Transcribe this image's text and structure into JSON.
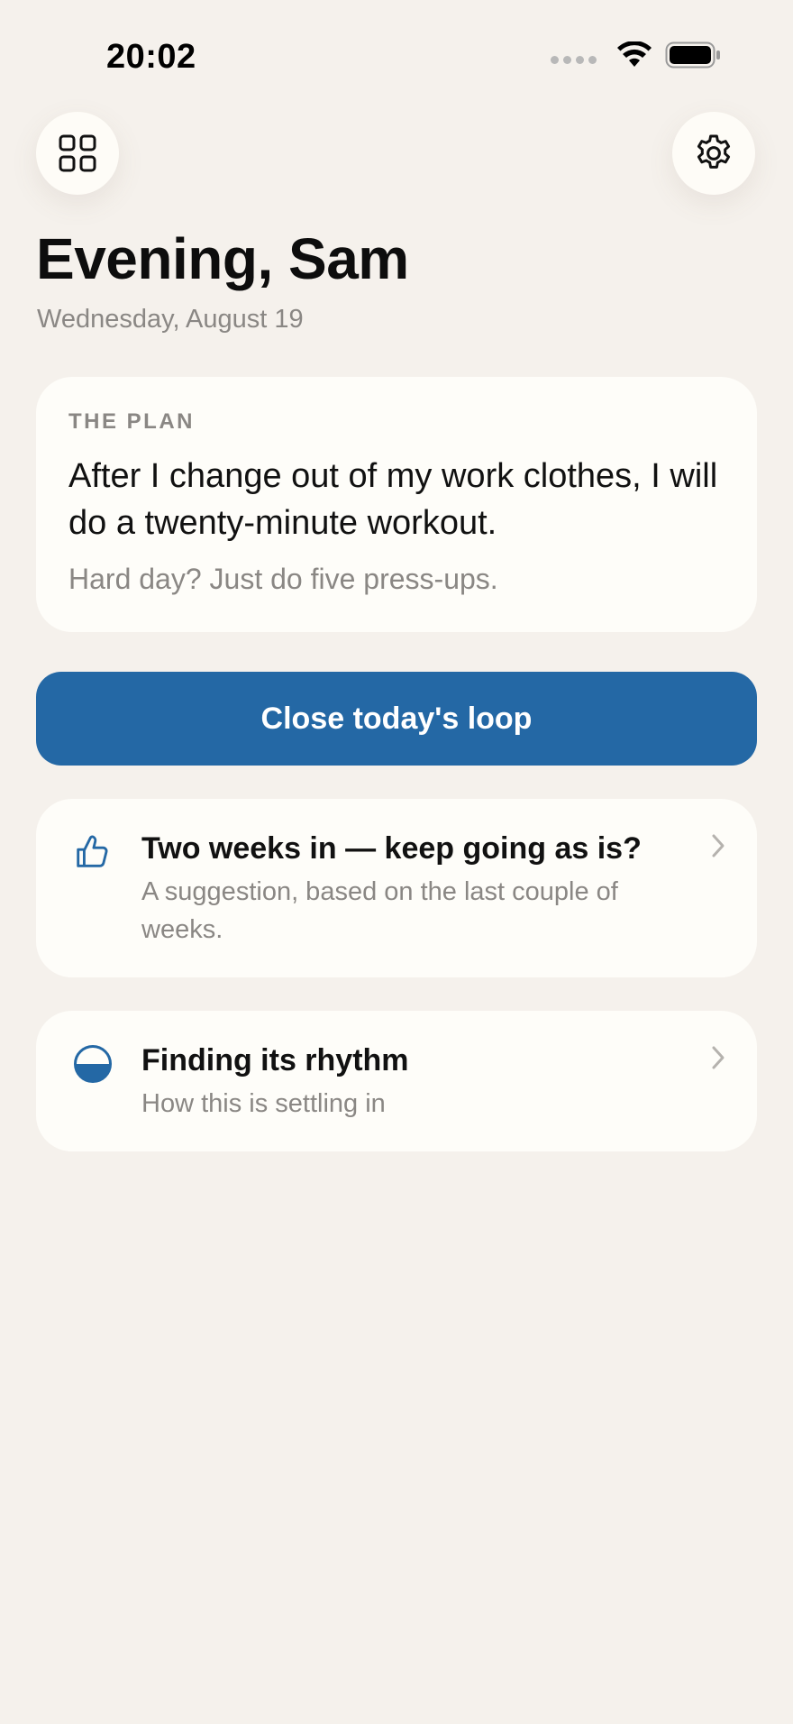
{
  "status_bar": {
    "time": "20:02",
    "icons": [
      "cellular-signal-icon",
      "wifi-icon",
      "battery-icon"
    ]
  },
  "toolbar": {
    "left_icon": "grid-icon",
    "right_icon": "gear-icon"
  },
  "header": {
    "greeting": "Evening, Sam",
    "date": "Wednesday, August 19"
  },
  "plan": {
    "label": "THE PLAN",
    "text": "After I change out of my work clothes, I will do a twenty-minute workout.",
    "fallback": "Hard day? Just do five press-ups."
  },
  "primary_action": {
    "label": "Close today's loop"
  },
  "cards": [
    {
      "icon": "thumbs-up-icon",
      "title": "Two weeks in — keep going as is?",
      "subtitle": "A suggestion, based on the last couple of weeks."
    },
    {
      "icon": "half-circle-icon",
      "title": "Finding its rhythm",
      "subtitle": "How this is settling in"
    }
  ],
  "colors": {
    "background": "#f5f1ec",
    "card": "#fefdf9",
    "accent": "#2468a5",
    "secondary_text": "#8a8784"
  }
}
